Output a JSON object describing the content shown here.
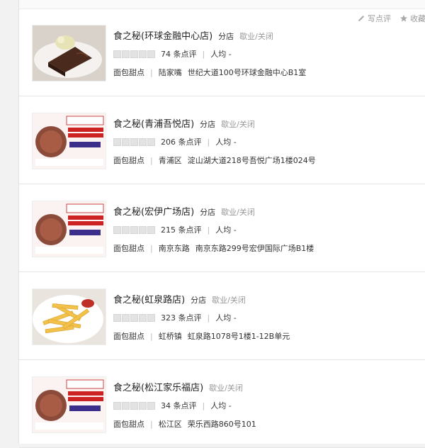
{
  "actions": {
    "write_review": "写点评",
    "favorite": "收藏"
  },
  "shops": [
    {
      "name": "食之秘(环球金融中心店)",
      "branch": "分店",
      "status": "歇业/关闭",
      "reviews": "74 条点评",
      "avg": "人均 -",
      "category": "面包甜点",
      "district": "陆家嘴",
      "address": "世纪大道100号环球金融中心B1室",
      "thumb": "chocolate-cake"
    },
    {
      "name": "食之秘(青浦吾悦店)",
      "branch": "分店",
      "status": "歇业/关闭",
      "reviews": "206 条点评",
      "avg": "人均 -",
      "category": "面包甜点",
      "district": "青浦区",
      "address": "淀山湖大道218号吾悦广场1楼024号",
      "thumb": "promo-poster"
    },
    {
      "name": "食之秘(宏伊广场店)",
      "branch": "分店",
      "status": "歇业/关闭",
      "reviews": "215 条点评",
      "avg": "人均 -",
      "category": "面包甜点",
      "district": "南京东路",
      "address": "南京东路299号宏伊国际广场B1楼",
      "thumb": "promo-poster"
    },
    {
      "name": "食之秘(虹泉路店)",
      "branch": "分店",
      "status": "歇业/关闭",
      "reviews": "323 条点评",
      "avg": "人均 -",
      "category": "面包甜点",
      "district": "虹桥镇",
      "address": "虹泉路1078号1楼1-12B单元",
      "thumb": "fries"
    },
    {
      "name": "食之秘(松江家乐福店)",
      "branch": "",
      "status": "歇业/关闭",
      "reviews": "34 条点评",
      "avg": "人均 -",
      "category": "面包甜点",
      "district": "松江区",
      "address": "荣乐西路860号101",
      "thumb": "promo-poster"
    }
  ]
}
